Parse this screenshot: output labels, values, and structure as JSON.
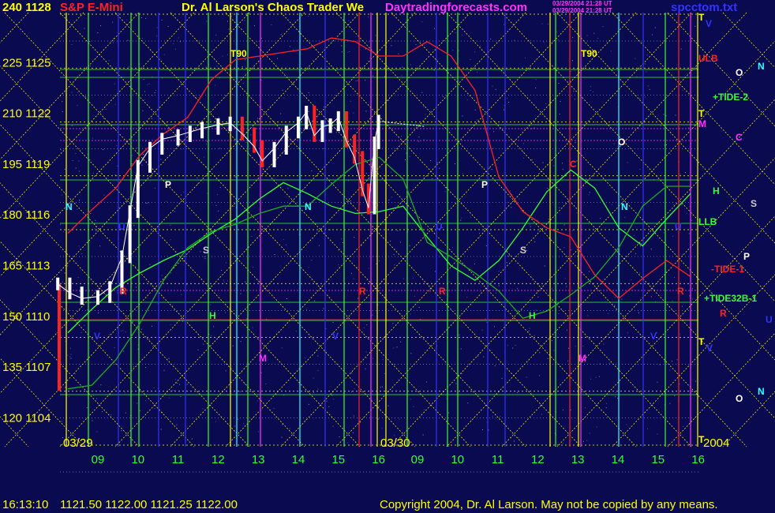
{
  "header": {
    "axis_top": "240  1128",
    "symbol": "S&P E-Mini",
    "title": "Dr. Al Larson's Chaos Trader We",
    "site": "Daytradingforecasts.com",
    "stamp_line1": "03/29/2004 21:28 UT",
    "stamp_line2": "03/29/2004 21:28 UT",
    "file": "spcctom.txt"
  },
  "footer": {
    "time": "16:13:10",
    "quote": "1121.50 1122.00 1121.25 1122.00",
    "copyright": "Copyright 2004, Dr. Al Larson. May not be copied by any means."
  },
  "colors": {
    "background": "#0a0a50",
    "yellow": "#ffff00",
    "green": "#33ff33",
    "red": "#ff2222",
    "magenta": "#ff33ff",
    "cyan": "#33ffff",
    "white": "#ffffff",
    "blue": "#3333ff"
  },
  "chart_data": {
    "type": "line",
    "title": "S&P E-Mini",
    "y_left_ticks": [
      "240",
      "225",
      "210",
      "195",
      "180",
      "165",
      "150",
      "135",
      "120"
    ],
    "y_right_ticks": [
      "1128",
      "1125",
      "1122",
      "1119",
      "1116",
      "1113",
      "1110",
      "1107",
      "1104"
    ],
    "ylim_price": [
      1104,
      1128
    ],
    "ylim_index": [
      120,
      240
    ],
    "x_ticks": [
      "09",
      "10",
      "11",
      "12",
      "13",
      "14",
      "15",
      "16",
      "09",
      "10",
      "11",
      "12",
      "13",
      "14",
      "15",
      "16"
    ],
    "dates": [
      "03/29",
      "03/30"
    ],
    "year": "2004",
    "price_bars": {
      "hour": [
        8.0,
        8.3,
        8.6,
        9.0,
        9.3,
        9.6,
        9.8,
        10.0,
        10.3,
        10.6,
        11.0,
        11.3,
        11.6,
        12.0,
        12.3,
        12.6,
        12.9,
        13.1,
        13.4,
        13.7,
        14.0,
        14.2,
        14.4,
        14.6,
        14.8,
        15.0,
        15.2,
        15.4,
        15.6,
        15.75,
        15.9,
        16.0
      ],
      "close": [
        1113.0,
        1112.5,
        1112.2,
        1112.3,
        1112.8,
        1114.5,
        1117.0,
        1119.5,
        1120.5,
        1121.0,
        1121.2,
        1121.4,
        1121.6,
        1121.8,
        1121.9,
        1121.3,
        1120.6,
        1119.8,
        1120.5,
        1121.4,
        1121.9,
        1122.5,
        1121.2,
        1121.7,
        1121.8,
        1122.2,
        1120.9,
        1120.0,
        1118.2,
        1117.2,
        1120.8,
        1122.0
      ]
    },
    "forecast_lines": [
      {
        "color": "#33ff33",
        "y": [
          1110.3,
          1111.6,
          1112.8,
          1113.6,
          1114.3,
          1114.9,
          1115.8,
          1116.6,
          1117.7,
          1118.6,
          1118.0,
          1117.3,
          1116.9,
          1117.0,
          1117.3,
          1115.6,
          1114.0,
          1113.2,
          1114.3,
          1116.1,
          1118.1,
          1119.3,
          1118.3,
          1116.1,
          1115.1,
          1116.6,
          1118.0
        ]
      },
      {
        "color": "#ff2222",
        "y": [
          1115.8,
          1117.1,
          1118.3,
          1120.1,
          1121.3,
          1122.2,
          1124.3,
          1125.4,
          1125.6,
          1125.8,
          1126.0,
          1126.6,
          1126.4,
          1125.6,
          1125.6,
          1126.4,
          1125.6,
          1123.7,
          1118.9,
          1117.0,
          1116.1,
          1115.6,
          1113.5,
          1112.2,
          1113.3,
          1114.3,
          1113.4
        ]
      },
      {
        "color": "#22aa22",
        "y": [
          1107.2,
          1107.4,
          1108.8,
          1110.8,
          1113.2,
          1115.0,
          1115.9,
          1116.3,
          1116.9,
          1117.3,
          1117.3,
          1118.5,
          1119.6,
          1120.0,
          1118.8,
          1115.3,
          1114.5,
          1113.6,
          1112.6,
          1111.1,
          1111.5,
          1112.4,
          1113.4,
          1115.0,
          1117.3,
          1118.4,
          1118.4
        ]
      }
    ],
    "grid": true,
    "right_labels": [
      {
        "text": "T",
        "color": "#ffff00"
      },
      {
        "text": "V",
        "color": "#3333ff"
      },
      {
        "text": "ULB",
        "color": "#ff2222"
      },
      {
        "text": "O",
        "color": "#ffffff"
      },
      {
        "text": "N",
        "color": "#33ffff"
      },
      {
        "text": "+TIDE-2",
        "color": "#33ff33"
      },
      {
        "text": "T",
        "color": "#ffff00"
      },
      {
        "text": "M",
        "color": "#ff33ff"
      },
      {
        "text": "C",
        "color": "#ff33ff"
      },
      {
        "text": "H",
        "color": "#33ff33"
      },
      {
        "text": "S",
        "color": "#cccccc"
      },
      {
        "text": "LLB",
        "color": "#33ff33"
      },
      {
        "text": "P",
        "color": "#ffffff"
      },
      {
        "text": "-TIDE-1",
        "color": "#ff2222"
      },
      {
        "text": "+TIDE32B-1",
        "color": "#33ff33"
      },
      {
        "text": "R",
        "color": "#ff2222"
      },
      {
        "text": "U",
        "color": "#3333ff"
      },
      {
        "text": "T",
        "color": "#ffff00"
      },
      {
        "text": "V",
        "color": "#3333ff"
      },
      {
        "text": "O",
        "color": "#ffffff"
      },
      {
        "text": "N",
        "color": "#33ffff"
      },
      {
        "text": "T",
        "color": "#ffff00"
      }
    ],
    "chart_annotations": [
      {
        "text": "T90",
        "color": "#ffff00"
      },
      {
        "text": "T90",
        "color": "#ffff00"
      },
      {
        "text": "P",
        "color": "#ffffff"
      },
      {
        "text": "P",
        "color": "#ffffff"
      },
      {
        "text": "S",
        "color": "#cccccc"
      },
      {
        "text": "S",
        "color": "#cccccc"
      },
      {
        "text": "H",
        "color": "#33ff33"
      },
      {
        "text": "H",
        "color": "#33ff33"
      },
      {
        "text": "N",
        "color": "#33ffff"
      },
      {
        "text": "N",
        "color": "#33ffff"
      },
      {
        "text": "N",
        "color": "#33ffff"
      },
      {
        "text": "M",
        "color": "#ff33ff"
      },
      {
        "text": "M",
        "color": "#ff33ff"
      },
      {
        "text": "R",
        "color": "#ff2222"
      },
      {
        "text": "R",
        "color": "#ff2222"
      },
      {
        "text": "R",
        "color": "#ff2222"
      },
      {
        "text": "R",
        "color": "#ff2222"
      },
      {
        "text": "C",
        "color": "#ff2222"
      },
      {
        "text": "O",
        "color": "#ffffff"
      },
      {
        "text": "V",
        "color": "#3333ff"
      },
      {
        "text": "V",
        "color": "#3333ff"
      },
      {
        "text": "V",
        "color": "#3333ff"
      },
      {
        "text": "U",
        "color": "#3333ff"
      },
      {
        "text": "U",
        "color": "#3333ff"
      },
      {
        "text": "U",
        "color": "#3333ff"
      }
    ]
  }
}
